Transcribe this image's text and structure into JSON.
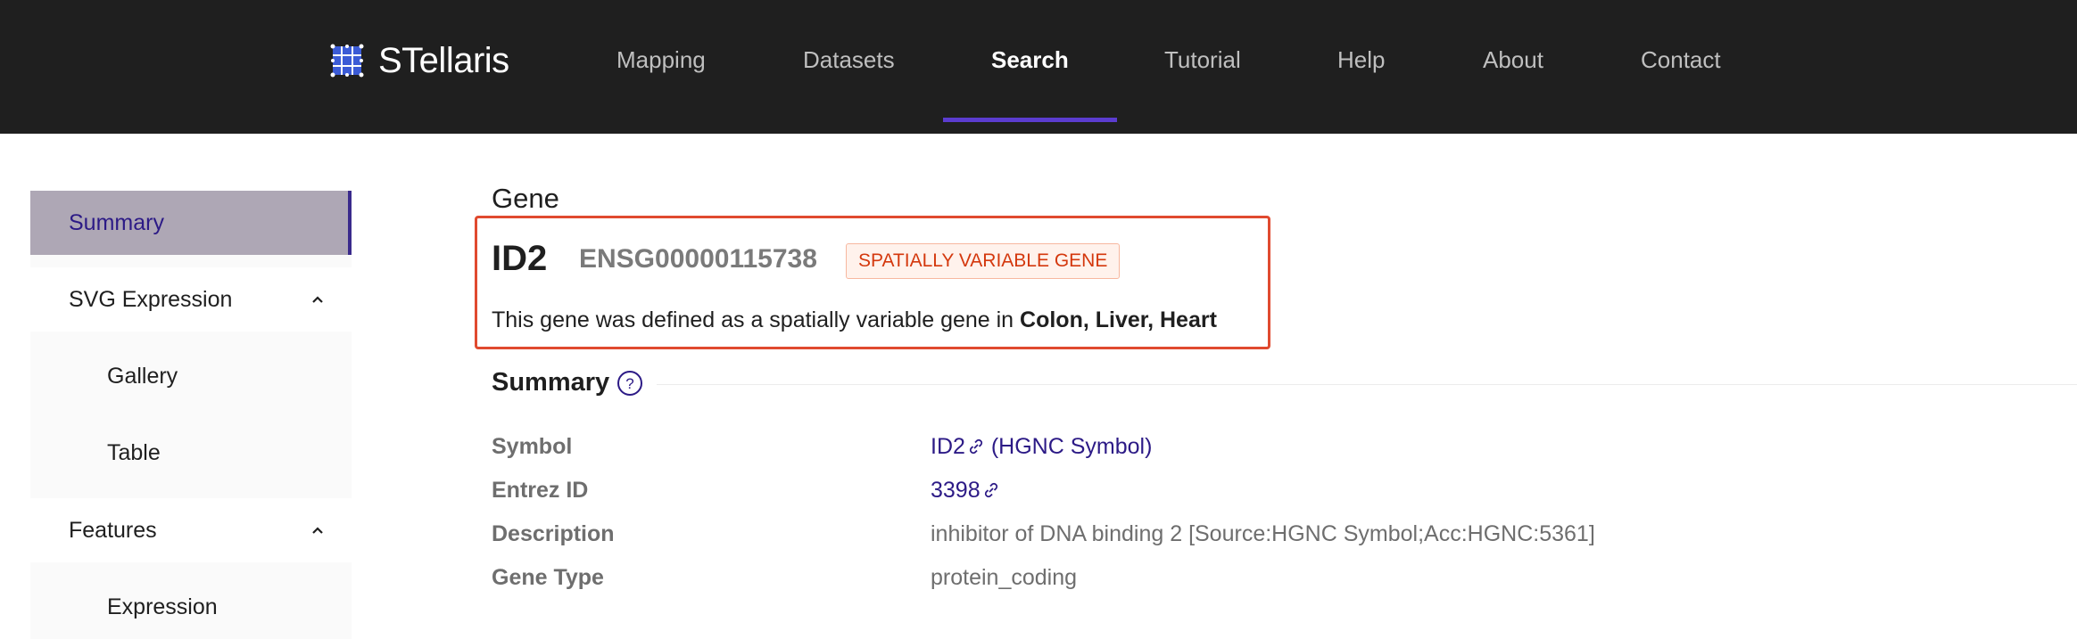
{
  "app": {
    "name": "STellaris"
  },
  "nav": {
    "items": [
      {
        "label": "Mapping"
      },
      {
        "label": "Datasets"
      },
      {
        "label": "Search",
        "active": true
      },
      {
        "label": "Tutorial"
      },
      {
        "label": "Help"
      },
      {
        "label": "About"
      },
      {
        "label": "Contact"
      }
    ]
  },
  "sidebar": {
    "items": [
      {
        "label": "Summary",
        "active": true
      },
      {
        "label": "SVG Expression",
        "expanded": true
      },
      {
        "label": "Gallery"
      },
      {
        "label": "Table"
      },
      {
        "label": "Features",
        "expanded": true
      },
      {
        "label": "Expression"
      }
    ]
  },
  "gene": {
    "heading": "Gene",
    "symbol": "ID2",
    "ensembl_id": "ENSG00000115738",
    "tag": "SPATIALLY VARIABLE GENE",
    "desc_prefix": "This gene was defined as a spatially variable gene in ",
    "desc_tissues": "Colon, Liver, Heart"
  },
  "summary": {
    "title": "Summary",
    "help_icon": "question-circle-icon",
    "rows": [
      {
        "label": "Symbol",
        "value": "ID2",
        "suffix": " (HGNC Symbol)",
        "link": true
      },
      {
        "label": "Entrez ID",
        "value": "3398",
        "link": true
      },
      {
        "label": "Description",
        "value": "inhibitor of DNA binding 2 [Source:HGNC Symbol;Acc:HGNC:5361]"
      },
      {
        "label": "Gene Type",
        "value": "protein_coding"
      }
    ]
  },
  "colors": {
    "nav_bg": "#1f1f1f",
    "accent": "#5b3ccf",
    "link": "#2c1a86",
    "highlight_border": "#e04a2f",
    "tag_text": "#d4380d"
  }
}
